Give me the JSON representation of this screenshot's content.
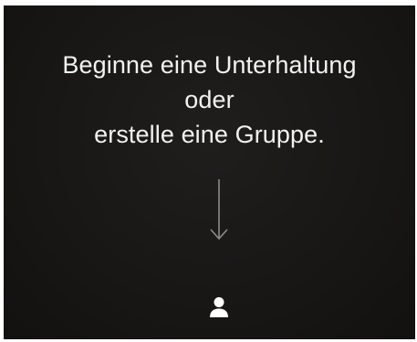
{
  "empty_state": {
    "line1": "Beginne eine Unterhaltung",
    "line2": "oder",
    "line3": "erstelle eine Gruppe."
  },
  "icons": {
    "arrow": "arrow-down-icon",
    "contact": "person-icon"
  },
  "colors": {
    "background": "#181716",
    "text": "#f2f2f2",
    "arrow": "#8a8a8a",
    "icon": "#ffffff"
  }
}
